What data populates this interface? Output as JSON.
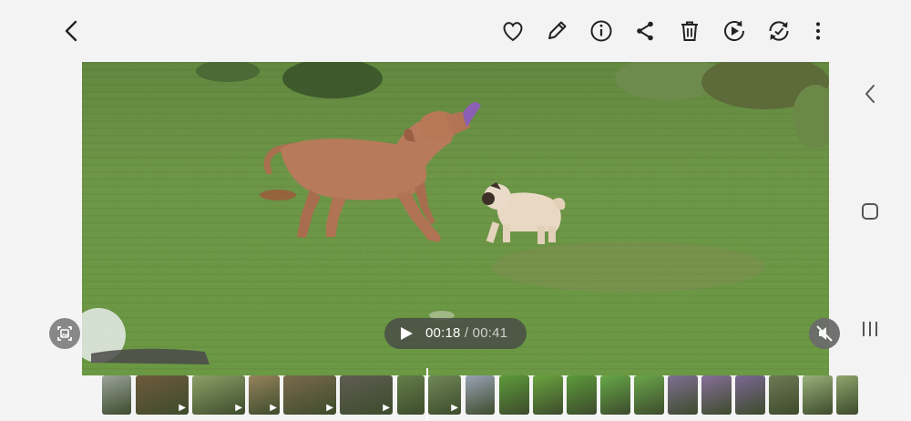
{
  "toolbar": {
    "back": "back",
    "actions": [
      "favorite",
      "edit",
      "details",
      "share",
      "delete",
      "play-video",
      "convert"
    ]
  },
  "player": {
    "current_time": "00:18",
    "separator": "/",
    "total_time": "00:41"
  },
  "colors": {
    "grass": "#5f8b3e",
    "dog_brown": "#b77a5a",
    "pug": "#e9d8c4",
    "toy": "#8b5fb3"
  },
  "filmstrip": [
    {
      "name": "thumb-1",
      "color": "#9aa39a",
      "video": false
    },
    {
      "name": "thumb-2",
      "color": "#6f5a3c",
      "video": true
    },
    {
      "name": "thumb-3",
      "color": "#8ea067",
      "video": true
    },
    {
      "name": "thumb-4",
      "color": "#96835c",
      "video": true
    },
    {
      "name": "thumb-5",
      "color": "#7b6a4c",
      "video": true
    },
    {
      "name": "thumb-6",
      "color": "#5f5d52",
      "video": true
    },
    {
      "name": "thumb-7",
      "color": "#647f4a",
      "video": false
    },
    {
      "name": "thumb-8",
      "color": "#708858",
      "video": true
    },
    {
      "name": "thumb-9",
      "color": "#9aa2b5",
      "video": false
    },
    {
      "name": "thumb-10",
      "color": "#5d9a3a",
      "video": false
    },
    {
      "name": "thumb-11",
      "color": "#6aa43e",
      "video": false
    },
    {
      "name": "thumb-12",
      "color": "#5c9a3a",
      "video": false
    },
    {
      "name": "thumb-13",
      "color": "#66a848",
      "video": false
    },
    {
      "name": "thumb-14",
      "color": "#6aa64b",
      "video": false
    },
    {
      "name": "thumb-15",
      "color": "#7f6f92",
      "video": false
    },
    {
      "name": "thumb-16",
      "color": "#876f9a",
      "video": false
    },
    {
      "name": "thumb-17",
      "color": "#7b6893",
      "video": false
    },
    {
      "name": "thumb-18",
      "color": "#6e7a55",
      "video": false
    },
    {
      "name": "thumb-19",
      "color": "#9ab07a",
      "video": false
    },
    {
      "name": "thumb-20",
      "color": "#8ea56c",
      "video": false
    }
  ]
}
